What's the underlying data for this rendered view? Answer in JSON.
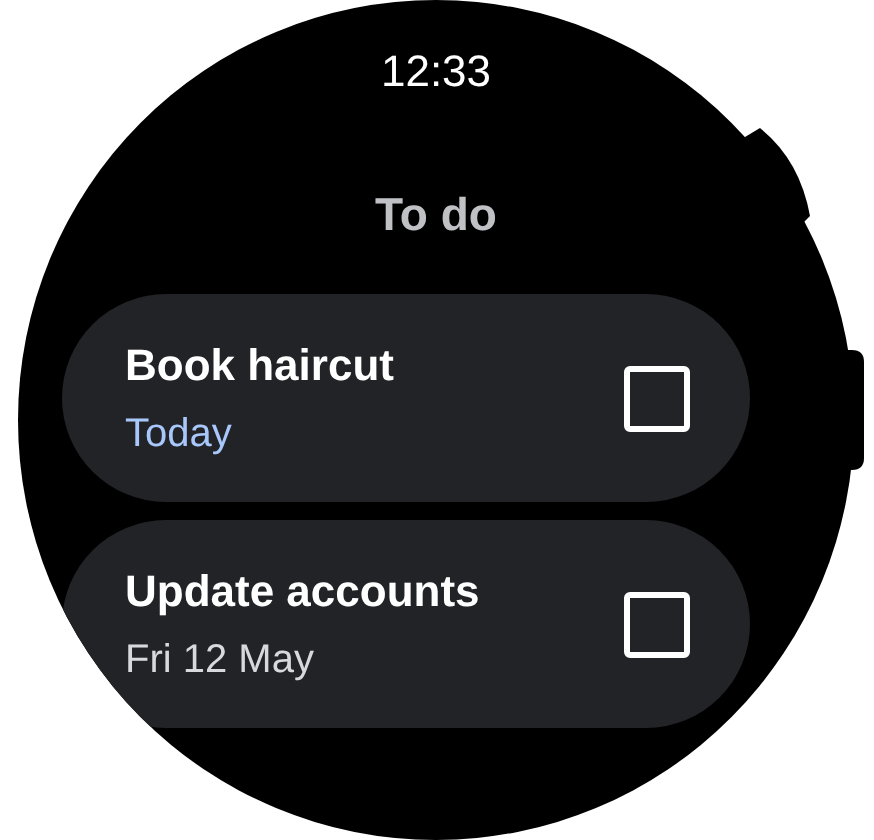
{
  "status": {
    "time": "12:33"
  },
  "title": "To do",
  "tasks": [
    {
      "title": "Book haircut",
      "date": "Today",
      "color": "#a8c7fa",
      "checked": false
    },
    {
      "title": "Update accounts",
      "date": "Fri 12 May",
      "color": "#d8d9dc",
      "checked": false
    }
  ]
}
